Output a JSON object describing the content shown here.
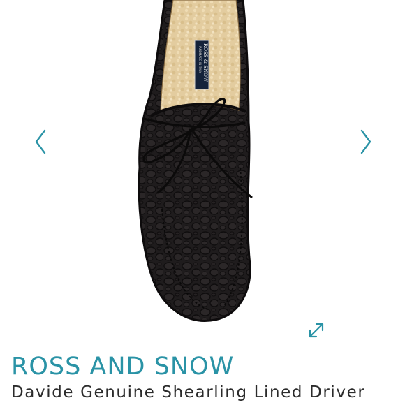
{
  "colors": {
    "accent": "#2a93a6",
    "nav_arrow": "#2a93a6",
    "shoe_leather": "#1f1c1d",
    "shearling": "#e6cfa3"
  },
  "gallery": {
    "prev_icon": "chevron-left-icon",
    "next_icon": "chevron-right-icon",
    "expand_icon": "expand-icon",
    "label_line1": "ROSS & SNOW",
    "label_line2": "HANDMADE IN ITALY"
  },
  "product": {
    "brand": "ROSS AND SNOW",
    "title": "Davide Genuine Shearling Lined Driver"
  }
}
